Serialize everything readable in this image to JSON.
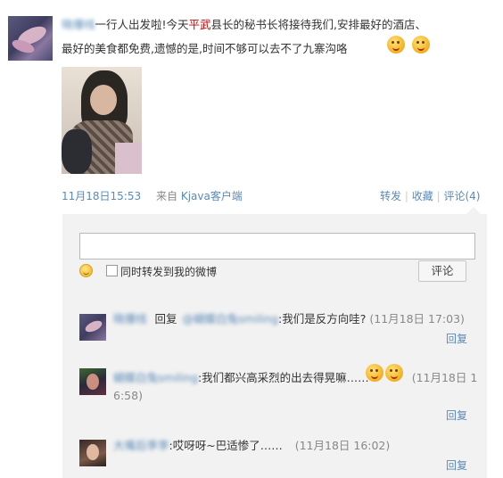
{
  "post": {
    "author": "晓爆线",
    "text_1": "一行人出发啦!今天",
    "text_hl": "平武",
    "text_2": "县长的秘书长将接待我们,安排最好的酒店、",
    "text_line2": "最好的美食都免费,遗憾的是,时间不够可以去不了九寨沟咯",
    "timestamp": "11月18日15:53",
    "source_prefix": "来自",
    "source": "Kjava客户端",
    "actions": {
      "repost": "转发",
      "favorite": "收藏",
      "comment": "评论(4)"
    }
  },
  "comment_box": {
    "input_value": "",
    "also_repost_label": "同时转发到我的微博",
    "submit_label": "评论"
  },
  "comments": [
    {
      "author": "晓爆线",
      "reply_word": "回复",
      "reply_to": "@蝴蝶白兔smiling",
      "text": ":我们是反方向哇?",
      "time": "(11月18日  17:03)",
      "reply_link": "回复"
    },
    {
      "author": "蝴蝶白兔smiling",
      "text": ":我们都兴高采烈的出去得晃嘛……",
      "time_1": "(11月18日  1",
      "time_2": "6:58)",
      "reply_link": "回复"
    },
    {
      "author": "大嘴后李李",
      "text": ":哎呀呀~巴适惨了……",
      "time": "(11月18日  16:02)",
      "reply_link": "回复"
    }
  ]
}
